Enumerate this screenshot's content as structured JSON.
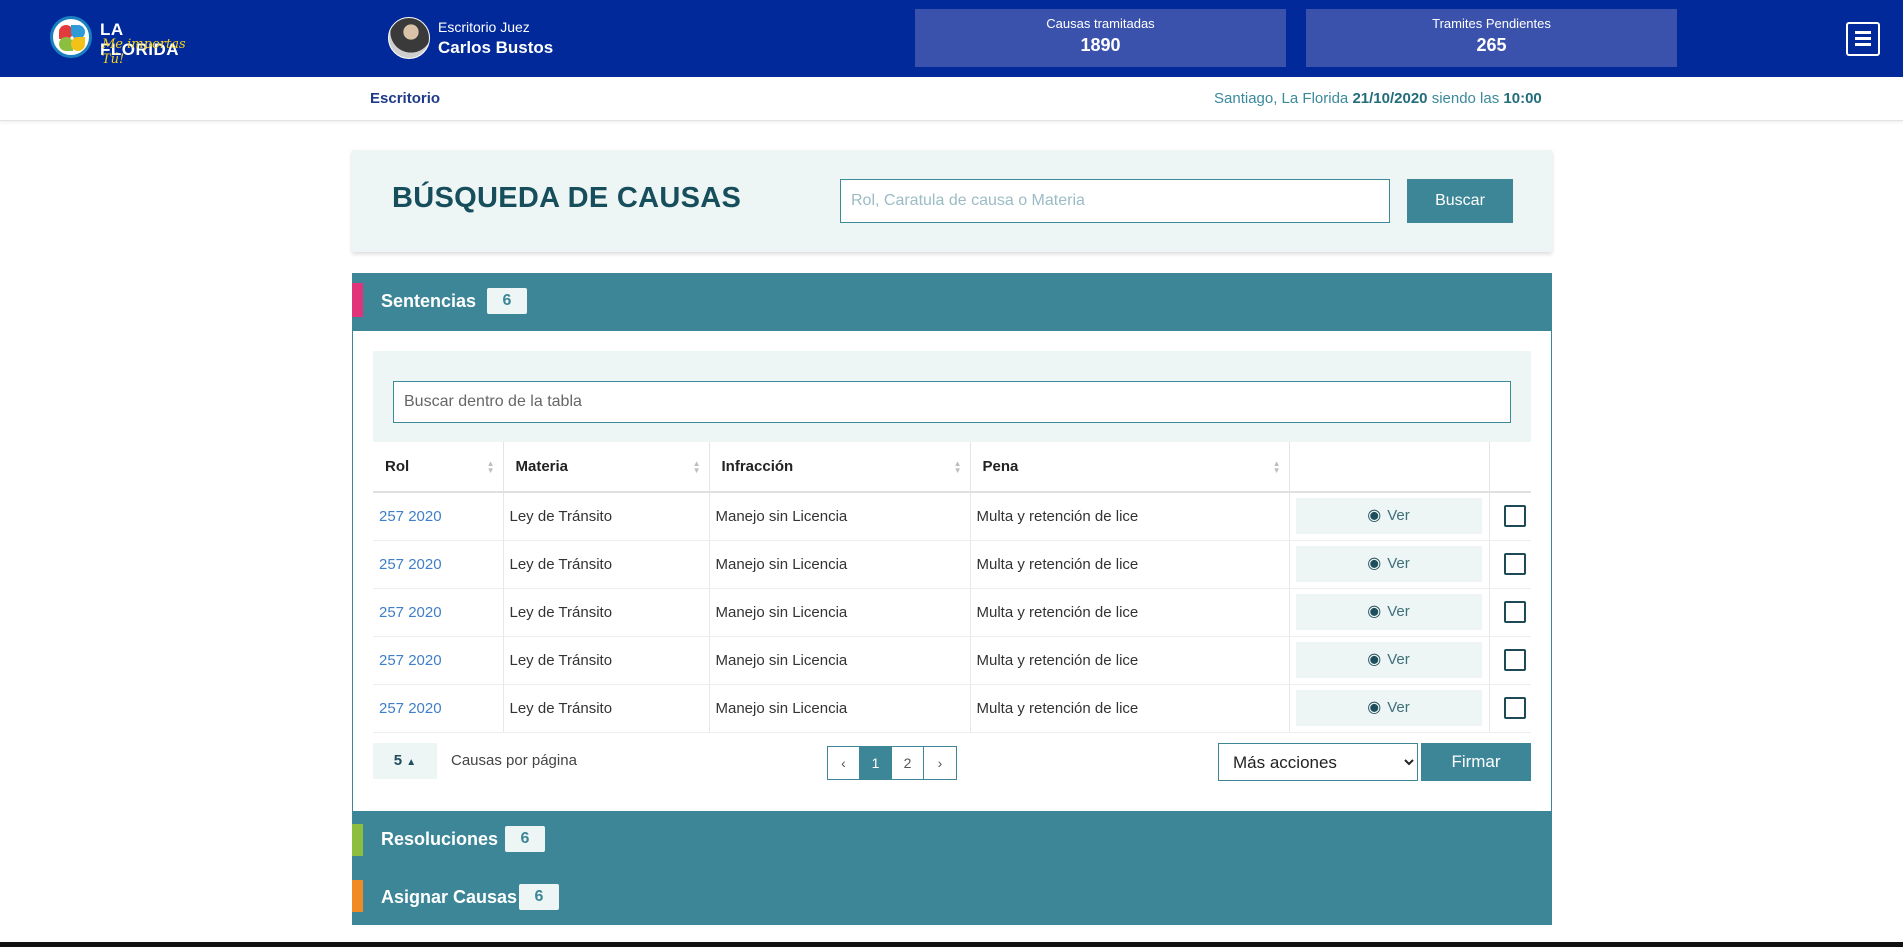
{
  "header": {
    "logo_title": "LA FLORIDA",
    "logo_tagline": "Me importas Tú!",
    "judge_role": "Escritorio Juez",
    "judge_name": "Carlos Bustos",
    "stats": [
      {
        "label": "Causas tramitadas",
        "value": "1890"
      },
      {
        "label": "Tramites Pendientes",
        "value": "265"
      }
    ],
    "menu_icon": "hamburger-icon"
  },
  "subbar": {
    "breadcrumb": "Escritorio",
    "location_prefix": "Santiago, La Florida",
    "date": "21/10/2020",
    "time_prefix": "siendo las",
    "time": "10:00"
  },
  "search": {
    "title": "BÚSQUEDA DE CAUSAS",
    "placeholder": "Rol, Caratula de causa o Materia",
    "button": "Buscar"
  },
  "sections": [
    {
      "title": "Sentencias",
      "count": "6",
      "color": "#e0337a"
    },
    {
      "title": "Resoluciones",
      "count": "6",
      "color": "#8cbf3f"
    },
    {
      "title": "Asignar Causas",
      "count": "6",
      "color": "#f08a24"
    }
  ],
  "table": {
    "filter_placeholder": "Buscar dentro de la tabla",
    "columns": [
      "Rol",
      "Materia",
      "Infracción",
      "Pena"
    ],
    "view_label": "Ver",
    "rows": [
      {
        "rol": "257 2020",
        "materia": "Ley de Tránsito",
        "infraccion": "Manejo sin Licencia",
        "pena": "Multa y retención de lice"
      },
      {
        "rol": "257 2020",
        "materia": "Ley de Tránsito",
        "infraccion": "Manejo sin Licencia",
        "pena": "Multa y retención de lice"
      },
      {
        "rol": "257 2020",
        "materia": "Ley de Tránsito",
        "infraccion": "Manejo sin Licencia",
        "pena": "Multa y retención de lice"
      },
      {
        "rol": "257 2020",
        "materia": "Ley de Tránsito",
        "infraccion": "Manejo sin Licencia",
        "pena": "Multa y retención de lice"
      },
      {
        "rol": "257 2020",
        "materia": "Ley de Tránsito",
        "infraccion": "Manejo sin Licencia",
        "pena": "Multa y retención de lice"
      }
    ]
  },
  "pagination": {
    "per_page": "5",
    "per_page_label": "Causas por página",
    "prev": "‹",
    "pages": [
      "1",
      "2"
    ],
    "next": "›",
    "actions_selected": "Más acciones",
    "sign_button": "Firmar"
  },
  "colors": {
    "topbar": "#02299a",
    "accent": "#3c8697",
    "panel": "#eef6f5",
    "link": "#3f7fc8"
  }
}
